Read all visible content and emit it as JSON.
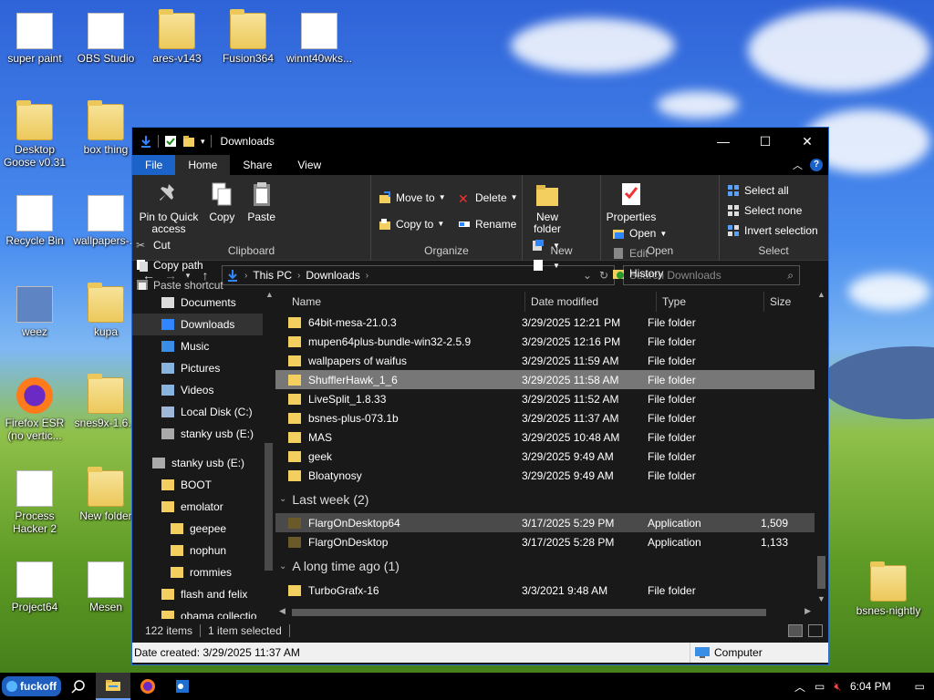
{
  "desktop": {
    "icons": [
      {
        "label": "super paint"
      },
      {
        "label": "OBS Studio"
      },
      {
        "label": "ares-v143"
      },
      {
        "label": "Fusion364"
      },
      {
        "label": "winnt40wks..."
      },
      {
        "label": "Desktop Goose v0.31"
      },
      {
        "label": "box thing"
      },
      {
        "label": "Recycle Bin"
      },
      {
        "label": "wallpapers-..."
      },
      {
        "label": "weez"
      },
      {
        "label": "kupa"
      },
      {
        "label": "Firefox ESR (no vertic..."
      },
      {
        "label": "snes9x-1.6..."
      },
      {
        "label": "Process Hacker 2"
      },
      {
        "label": "New folder"
      },
      {
        "label": "Project64"
      },
      {
        "label": "Mesen"
      },
      {
        "label": "bsnes-nightly"
      }
    ]
  },
  "window": {
    "title": "Downloads",
    "controls": {
      "minimize": "—",
      "maximize": "☐",
      "close": "✕"
    },
    "tabs": [
      "File",
      "Home",
      "Share",
      "View"
    ],
    "help": "?",
    "ribbon": {
      "clipboard": {
        "label": "Clipboard",
        "pin": "Pin to Quick access",
        "copy": "Copy",
        "paste": "Paste",
        "cut": "Cut",
        "copy_path": "Copy path",
        "paste_shortcut": "Paste shortcut"
      },
      "organize": {
        "label": "Organize",
        "move_to": "Move to",
        "copy_to": "Copy to",
        "delete": "Delete",
        "rename": "Rename"
      },
      "new": {
        "label": "New",
        "new_folder": "New folder"
      },
      "open": {
        "label": "Open",
        "properties": "Properties",
        "open": "Open",
        "edit": "Edit",
        "history": "History"
      },
      "select": {
        "label": "Select",
        "select_all": "Select all",
        "select_none": "Select none",
        "invert": "Invert selection"
      }
    },
    "address": {
      "crumbs": [
        "This PC",
        "Downloads"
      ],
      "search_placeholder": "Search Downloads"
    },
    "nav": [
      {
        "label": "Documents",
        "indent": 1,
        "icon": "documents-icon"
      },
      {
        "label": "Downloads",
        "indent": 1,
        "icon": "downloads-icon",
        "selected": true
      },
      {
        "label": "Music",
        "indent": 1,
        "icon": "music-icon"
      },
      {
        "label": "Pictures",
        "indent": 1,
        "icon": "pictures-icon"
      },
      {
        "label": "Videos",
        "indent": 1,
        "icon": "videos-icon"
      },
      {
        "label": "Local Disk (C:)",
        "indent": 1,
        "icon": "disk-icon"
      },
      {
        "label": "stanky usb (E:)",
        "indent": 1,
        "icon": "usb-icon"
      },
      {
        "label": "",
        "indent": 0,
        "icon": "spacer"
      },
      {
        "label": "stanky usb (E:)",
        "indent": 0,
        "icon": "usb-icon"
      },
      {
        "label": "BOOT",
        "indent": 1,
        "icon": "folder-icon"
      },
      {
        "label": "emolator",
        "indent": 1,
        "icon": "folder-icon"
      },
      {
        "label": "geepee",
        "indent": 2,
        "icon": "folder-icon"
      },
      {
        "label": "nophun",
        "indent": 2,
        "icon": "folder-icon"
      },
      {
        "label": "rommies",
        "indent": 2,
        "icon": "folder-icon"
      },
      {
        "label": "flash and felix",
        "indent": 1,
        "icon": "folder-icon"
      },
      {
        "label": "obama collectio",
        "indent": 1,
        "icon": "folder-icon"
      }
    ],
    "columns": {
      "name": "Name",
      "date": "Date modified",
      "type": "Type",
      "size": "Size"
    },
    "files_recent": [
      {
        "name": "64bit-mesa-21.0.3",
        "date": "3/29/2025 12:21 PM",
        "type": "File folder",
        "size": ""
      },
      {
        "name": "mupen64plus-bundle-win32-2.5.9",
        "date": "3/29/2025 12:16 PM",
        "type": "File folder",
        "size": ""
      },
      {
        "name": "wallpapers of waifus",
        "date": "3/29/2025 11:59 AM",
        "type": "File folder",
        "size": ""
      },
      {
        "name": "ShufflerHawk_1_6",
        "date": "3/29/2025 11:58 AM",
        "type": "File folder",
        "size": "",
        "selected": true
      },
      {
        "name": "LiveSplit_1.8.33",
        "date": "3/29/2025 11:52 AM",
        "type": "File folder",
        "size": ""
      },
      {
        "name": "bsnes-plus-073.1b",
        "date": "3/29/2025 11:37 AM",
        "type": "File folder",
        "size": ""
      },
      {
        "name": "MAS",
        "date": "3/29/2025 10:48 AM",
        "type": "File folder",
        "size": ""
      },
      {
        "name": "geek",
        "date": "3/29/2025 9:49 AM",
        "type": "File folder",
        "size": ""
      },
      {
        "name": "Bloatynosy",
        "date": "3/29/2025 9:49 AM",
        "type": "File folder",
        "size": ""
      }
    ],
    "group_last_week": "Last week (2)",
    "files_last_week": [
      {
        "name": "FlargOnDesktop64",
        "date": "3/17/2025 5:29 PM",
        "type": "Application",
        "size": "1,509",
        "hover": true
      },
      {
        "name": "FlargOnDesktop",
        "date": "3/17/2025 5:28 PM",
        "type": "Application",
        "size": "1,133"
      }
    ],
    "group_long_ago": "A long time ago (1)",
    "files_long_ago": [
      {
        "name": "TurboGrafx-16",
        "date": "3/3/2021 9:48 AM",
        "type": "File folder",
        "size": ""
      }
    ],
    "status": {
      "items": "122 items",
      "selected": "1 item selected"
    },
    "details": {
      "created": "Date created: 3/29/2025 11:37 AM",
      "location": "Computer"
    }
  },
  "taskbar": {
    "start_label": "fuckoff",
    "clock": "6:04 PM"
  }
}
